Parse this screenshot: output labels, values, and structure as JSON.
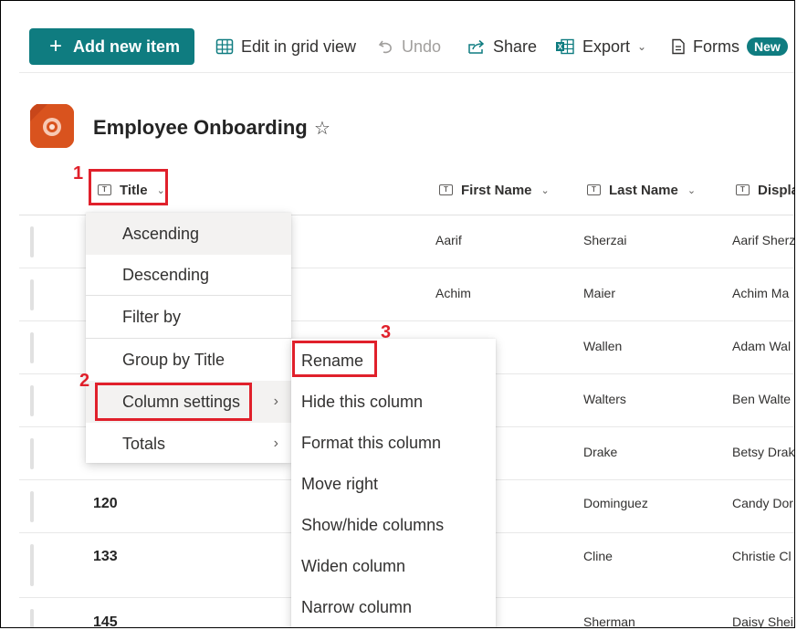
{
  "toolbar": {
    "add_new_item": "Add new item",
    "edit_grid": "Edit in grid view",
    "undo": "Undo",
    "share": "Share",
    "export": "Export",
    "forms": "Forms",
    "forms_badge": "New"
  },
  "list": {
    "title": "Employee Onboarding",
    "favorite_icon": "star-icon"
  },
  "columns": {
    "title": "Title",
    "first_name": "First Name",
    "last_name": "Last Name",
    "display": "Displa"
  },
  "rows": [
    {
      "title": "",
      "first": "Aarif",
      "last": "Sherzai",
      "display": "Aarif Sherz"
    },
    {
      "title": "",
      "first": "Achim",
      "last": "Maier",
      "display": "Achim Ma"
    },
    {
      "title": "",
      "first": "",
      "last": "Wallen",
      "display": "Adam Wal"
    },
    {
      "title": "",
      "first": "",
      "last": "Walters",
      "display": "Ben Walte"
    },
    {
      "title": "",
      "first": "",
      "last": "Drake",
      "display": "Betsy Drak"
    },
    {
      "title": "120",
      "first": "",
      "last": "Dominguez",
      "display": "Candy Dor"
    },
    {
      "title": "133",
      "first": "",
      "last": "Cline",
      "display": "Christie Cl"
    },
    {
      "title": "145",
      "first": "",
      "last": "Sherman",
      "display": "Daisy Shei"
    }
  ],
  "column_menu": {
    "ascending": "Ascending",
    "descending": "Descending",
    "filter_by": "Filter by",
    "group_by": "Group by Title",
    "column_settings": "Column settings",
    "totals": "Totals"
  },
  "settings_submenu": {
    "rename": "Rename",
    "hide": "Hide this column",
    "format": "Format this column",
    "move_right": "Move right",
    "show_hide": "Show/hide columns",
    "widen": "Widen column",
    "narrow": "Narrow column"
  },
  "annotations": {
    "step1": "1",
    "step2": "2",
    "step3": "3",
    "color": "#e0202b"
  },
  "colors": {
    "accent": "#0f7c80",
    "list_icon": "#d9531e"
  }
}
